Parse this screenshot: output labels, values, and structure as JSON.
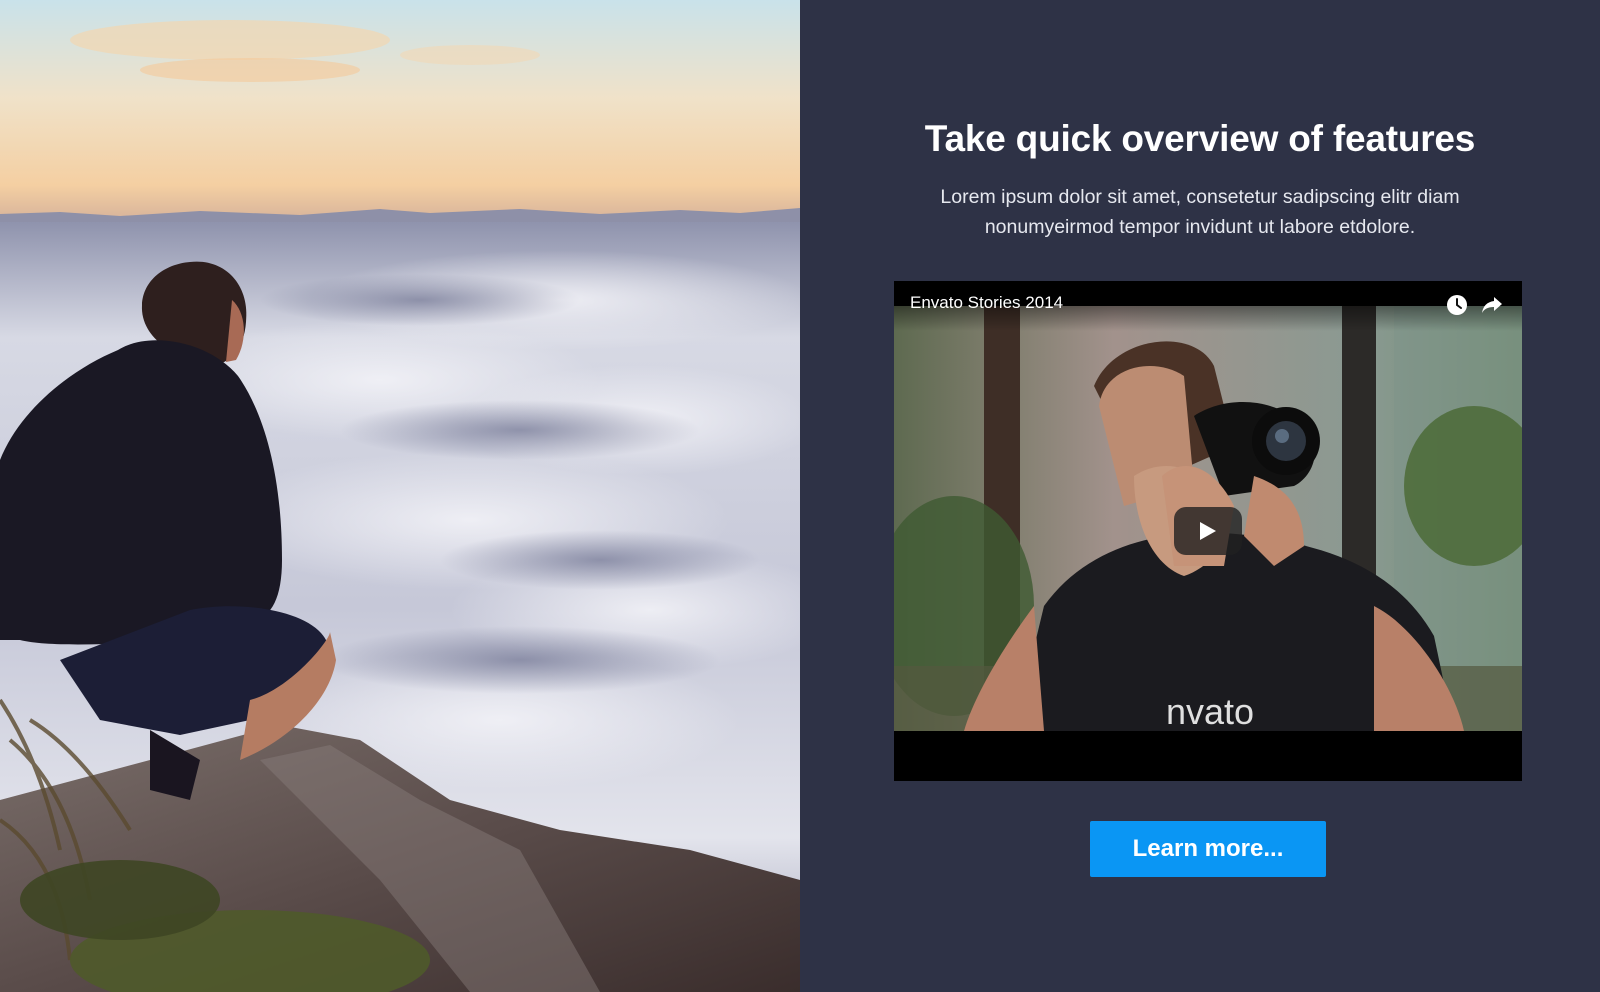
{
  "hero": {
    "title": "Take quick overview of features",
    "subtitle": "Lorem ipsum dolor sit amet, consetetur sadipscing elitr diam nonumyeirmod tempor invidunt ut labore etdolore."
  },
  "video": {
    "title": "Envato Stories 2014",
    "shirt_text": "nvato",
    "icons": [
      "watch-later-icon",
      "share-icon",
      "play-icon"
    ]
  },
  "cta": {
    "label": "Learn more..."
  },
  "colors": {
    "background": "#2e3246",
    "button": "#0a96f4",
    "text": "#ffffff"
  }
}
